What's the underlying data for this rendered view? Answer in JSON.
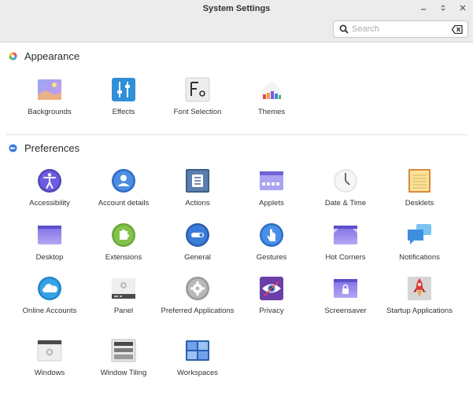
{
  "window": {
    "title": "System Settings",
    "controls": [
      "minimize",
      "restore",
      "close"
    ]
  },
  "search": {
    "placeholder": "Search",
    "value": ""
  },
  "sections": {
    "appearance": {
      "label": "Appearance",
      "items": [
        {
          "label": "Backgrounds",
          "icon": "backgrounds-icon"
        },
        {
          "label": "Effects",
          "icon": "effects-icon"
        },
        {
          "label": "Font Selection",
          "icon": "font-selection-icon"
        },
        {
          "label": "Themes",
          "icon": "themes-icon"
        }
      ]
    },
    "preferences": {
      "label": "Preferences",
      "items": [
        {
          "label": "Accessibility",
          "icon": "accessibility-icon"
        },
        {
          "label": "Account details",
          "icon": "account-details-icon"
        },
        {
          "label": "Actions",
          "icon": "actions-icon"
        },
        {
          "label": "Applets",
          "icon": "applets-icon"
        },
        {
          "label": "Date & Time",
          "icon": "date-time-icon"
        },
        {
          "label": "Desklets",
          "icon": "desklets-icon"
        },
        {
          "label": "Desktop",
          "icon": "desktop-icon"
        },
        {
          "label": "Extensions",
          "icon": "extensions-icon"
        },
        {
          "label": "General",
          "icon": "general-icon"
        },
        {
          "label": "Gestures",
          "icon": "gestures-icon"
        },
        {
          "label": "Hot Corners",
          "icon": "hot-corners-icon"
        },
        {
          "label": "Notifications",
          "icon": "notifications-icon"
        },
        {
          "label": "Online Accounts",
          "icon": "online-accounts-icon"
        },
        {
          "label": "Panel",
          "icon": "panel-icon"
        },
        {
          "label": "Preferred Applications",
          "icon": "preferred-applications-icon"
        },
        {
          "label": "Privacy",
          "icon": "privacy-icon"
        },
        {
          "label": "Screensaver",
          "icon": "screensaver-icon"
        },
        {
          "label": "Startup Applications",
          "icon": "startup-applications-icon"
        },
        {
          "label": "Windows",
          "icon": "windows-icon"
        },
        {
          "label": "Window Tiling",
          "icon": "window-tiling-icon"
        },
        {
          "label": "Workspaces",
          "icon": "workspaces-icon"
        }
      ]
    }
  },
  "colors": {
    "titlebar": "#ececec",
    "accent_blue": "#3d7bd9",
    "purple": "#6b5bd6"
  }
}
